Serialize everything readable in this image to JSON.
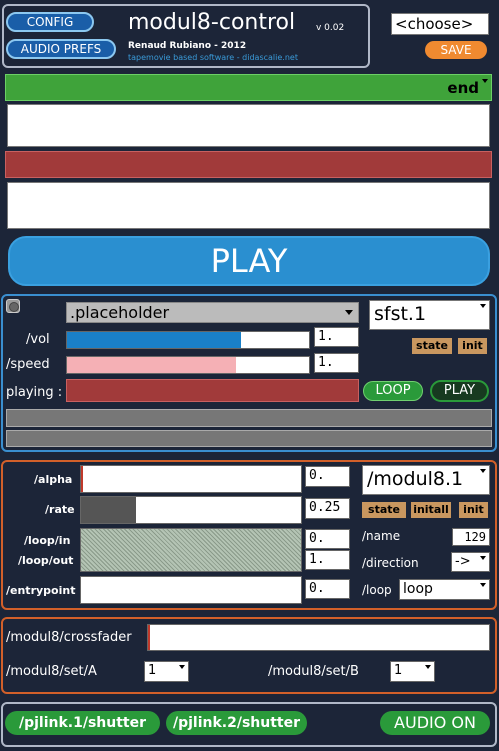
{
  "header": {
    "config_label": "CONFIG",
    "audio_prefs_label": "AUDIO PREFS",
    "title": "modul8-control",
    "version": "v 0.02",
    "author": "Renaud Rubiano - 2012",
    "tagline": "tapemovie based software - didascalie.net",
    "preset_select": "<choose>",
    "save_label": "SAVE"
  },
  "cue": {
    "cue_name": "end",
    "play_label": "PLAY"
  },
  "sound": {
    "file_select": ".placeholder",
    "vol_label": "/vol",
    "vol_value": "1.",
    "vol_level": 0.72,
    "speed_label": "/speed",
    "speed_value": "1.",
    "speed_level": 0.7,
    "playing_label": "playing :",
    "loop_label": "LOOP",
    "play_label": "PLAY",
    "target": "sfst.1",
    "state_label": "state",
    "init_label": "init"
  },
  "modul8": {
    "alpha_label": "/alpha",
    "alpha_value": "0.",
    "rate_label": "/rate",
    "rate_value": "0.25",
    "loop_in_label": "/loop/in",
    "loop_out_label": "/loop/out",
    "loop_in_value": "0.",
    "loop_out_value": "1.",
    "entrypoint_label": "/entrypoint",
    "entrypoint_value": "0.",
    "target": "/modul8.1",
    "state_label": "state",
    "initall_label": "initall",
    "init_label": "init",
    "name_label": "/name",
    "name_value": "129",
    "direction_label": "/direction",
    "direction_value": "->",
    "loop_mode_label": "/loop",
    "loop_mode_value": "loop"
  },
  "crossfader": {
    "label": "/modul8/crossfader",
    "set_a_label": "/modul8/set/A",
    "set_a_value": "1",
    "set_b_label": "/modul8/set/B",
    "set_b_value": "1"
  },
  "footer": {
    "shutter1_label": "/pjlink.1/shutter",
    "shutter2_label": "/pjlink.2/shutter",
    "audio_on_label": "AUDIO ON"
  },
  "colors": {
    "background": "#1c2538",
    "cue_green": "#3fa33a",
    "cue_red": "#a13a3a",
    "play_blue": "#2a8fd0",
    "panel_blue_border": "#3a8fd0",
    "panel_orange_border": "#d2602a",
    "vol_bar": "#1a80c8",
    "speed_bar": "#f5b0b5",
    "tag_tan": "#c9975f",
    "save_orange": "#f08a30",
    "button_green": "#2a9a3a"
  }
}
